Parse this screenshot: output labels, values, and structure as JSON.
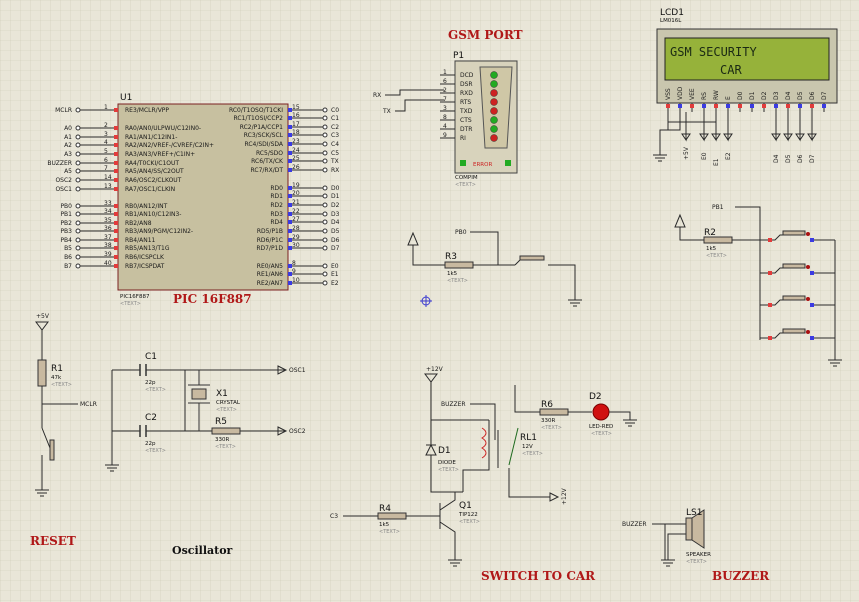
{
  "titles": {
    "pic": "PIC 16F887",
    "gsm_port": "GSM PORT",
    "reset": "RESET",
    "oscillator": "Oscillator",
    "switch_to_car": "SWITCH TO CAR",
    "buzzer": "BUZZER"
  },
  "mcu": {
    "ref": "U1",
    "part": "PIC16F887",
    "text": "<TEXT>",
    "left_pins": [
      {
        "net": "MCLR",
        "num": "1",
        "name": "RE3/MCLR/VPP"
      },
      {
        "net": "A0",
        "num": "2",
        "name": "RA0/AN0/ULPWU/C12IN0-"
      },
      {
        "net": "A1",
        "num": "3",
        "name": "RA1/AN1/C12IN1-"
      },
      {
        "net": "A2",
        "num": "4",
        "name": "RA2/AN2/VREF-/CVREF/C2IN+"
      },
      {
        "net": "A3",
        "num": "5",
        "name": "RA3/AN3/VREF+/C1IN+"
      },
      {
        "net": "BUZZER",
        "num": "6",
        "name": "RA4/T0CKI/C1OUT"
      },
      {
        "net": "A5",
        "num": "7",
        "name": "RA5/AN4/SS/C2OUT"
      },
      {
        "net": "OSC2",
        "num": "14",
        "name": "RA6/OSC2/CLKOUT"
      },
      {
        "net": "OSC1",
        "num": "13",
        "name": "RA7/OSC1/CLKIN"
      },
      {
        "net": "PB0",
        "num": "33",
        "name": "RB0/AN12/INT"
      },
      {
        "net": "PB1",
        "num": "34",
        "name": "RB1/AN10/C12IN3-"
      },
      {
        "net": "PB2",
        "num": "35",
        "name": "RB2/AN8"
      },
      {
        "net": "PB3",
        "num": "36",
        "name": "RB3/AN9/PGM/C12IN2-"
      },
      {
        "net": "PB4",
        "num": "37",
        "name": "RB4/AN11"
      },
      {
        "net": "B5",
        "num": "38",
        "name": "RB5/AN13/T1G"
      },
      {
        "net": "B6",
        "num": "39",
        "name": "RB6/ICSPCLK"
      },
      {
        "net": "B7",
        "num": "40",
        "name": "RB7/ICSPDAT"
      }
    ],
    "right_pins": [
      {
        "net": "C0",
        "num": "15",
        "name": "RC0/T1OSO/T1CKI"
      },
      {
        "net": "C1",
        "num": "16",
        "name": "RC1/T1OSI/CCP2"
      },
      {
        "net": "C2",
        "num": "17",
        "name": "RC2/P1A/CCP1"
      },
      {
        "net": "C3",
        "num": "18",
        "name": "RC3/SCK/SCL"
      },
      {
        "net": "C4",
        "num": "23",
        "name": "RC4/SDI/SDA"
      },
      {
        "net": "C5",
        "num": "24",
        "name": "RC5/SDO"
      },
      {
        "net": "TX",
        "num": "25",
        "name": "RC6/TX/CK"
      },
      {
        "net": "RX",
        "num": "26",
        "name": "RC7/RX/DT"
      },
      {
        "net": "D0",
        "num": "19",
        "name": "RD0"
      },
      {
        "net": "D1",
        "num": "20",
        "name": "RD1"
      },
      {
        "net": "D2",
        "num": "21",
        "name": "RD2"
      },
      {
        "net": "D3",
        "num": "22",
        "name": "RD3"
      },
      {
        "net": "D4",
        "num": "27",
        "name": "RD4"
      },
      {
        "net": "D5",
        "num": "28",
        "name": "RD5/P1B"
      },
      {
        "net": "D6",
        "num": "29",
        "name": "RD6/P1C"
      },
      {
        "net": "D7",
        "num": "30",
        "name": "RD7/P1D"
      },
      {
        "net": "E0",
        "num": "8",
        "name": "RE0/AN5"
      },
      {
        "net": "E1",
        "num": "9",
        "name": "RE1/AN6"
      },
      {
        "net": "E2",
        "num": "10",
        "name": "RE2/AN7"
      }
    ]
  },
  "gsm": {
    "ref": "P1",
    "part": "COMPIM",
    "text": "<TEXT>",
    "error": "ERROR",
    "pins": [
      {
        "num": "1",
        "name": "DCD"
      },
      {
        "num": "6",
        "name": "DSR"
      },
      {
        "num": "2",
        "name": "RXD"
      },
      {
        "num": "7",
        "name": "RTS"
      },
      {
        "num": "3",
        "name": "TXD"
      },
      {
        "num": "8",
        "name": "CTS"
      },
      {
        "num": "4",
        "name": "DTR"
      },
      {
        "num": "9",
        "name": "RI"
      }
    ],
    "nets": {
      "rx": "RX",
      "tx": "TX"
    }
  },
  "lcd": {
    "ref": "LCD1",
    "part": "LM016L",
    "line1": "GSM SECURITY",
    "line2": "CAR",
    "pins": [
      "VSS",
      "VDD",
      "VEE",
      "RS",
      "RW",
      "E",
      "D0",
      "D1",
      "D2",
      "D3",
      "D4",
      "D5",
      "D6",
      "D7"
    ],
    "bottom_nets": [
      "+5V",
      "E0",
      "E1",
      "E2",
      "D4",
      "D5",
      "D6",
      "D7"
    ]
  },
  "components": {
    "R1": {
      "ref": "R1",
      "value": "47k",
      "text": "<TEXT>"
    },
    "R2": {
      "ref": "R2",
      "value": "1k5",
      "text": "<TEXT>"
    },
    "R3": {
      "ref": "R3",
      "value": "1k5",
      "text": "<TEXT>"
    },
    "R4": {
      "ref": "R4",
      "value": "1k5",
      "text": "<TEXT>"
    },
    "R5": {
      "ref": "R5",
      "value": "330R",
      "text": "<TEXT>"
    },
    "R6": {
      "ref": "R6",
      "value": "330R",
      "text": "<TEXT>"
    },
    "C1": {
      "ref": "C1",
      "value": "22p",
      "text": "<TEXT>"
    },
    "C2": {
      "ref": "C2",
      "value": "22p",
      "text": "<TEXT>"
    },
    "X1": {
      "ref": "X1",
      "value": "CRYSTAL",
      "text": "<TEXT>"
    },
    "D1": {
      "ref": "D1",
      "value": "DIODE",
      "text": "<TEXT>"
    },
    "D2": {
      "ref": "D2",
      "value": "LED-RED",
      "text": "<TEXT>"
    },
    "Q1": {
      "ref": "Q1",
      "value": "TIP122",
      "text": "<TEXT>"
    },
    "RL1": {
      "ref": "RL1",
      "value": "12V",
      "text": "<TEXT>"
    },
    "LS1": {
      "ref": "LS1",
      "value": "SPEAKER",
      "text": "<TEXT>"
    }
  },
  "nets": {
    "plus5v": "+5V",
    "mclr": "MCLR",
    "osc1": "OSC1",
    "osc2": "OSC2",
    "plus12v": "+12V",
    "buzzer": "BUZZER",
    "c3": "C3",
    "pb0": "PB0",
    "pb1": "PB1"
  }
}
